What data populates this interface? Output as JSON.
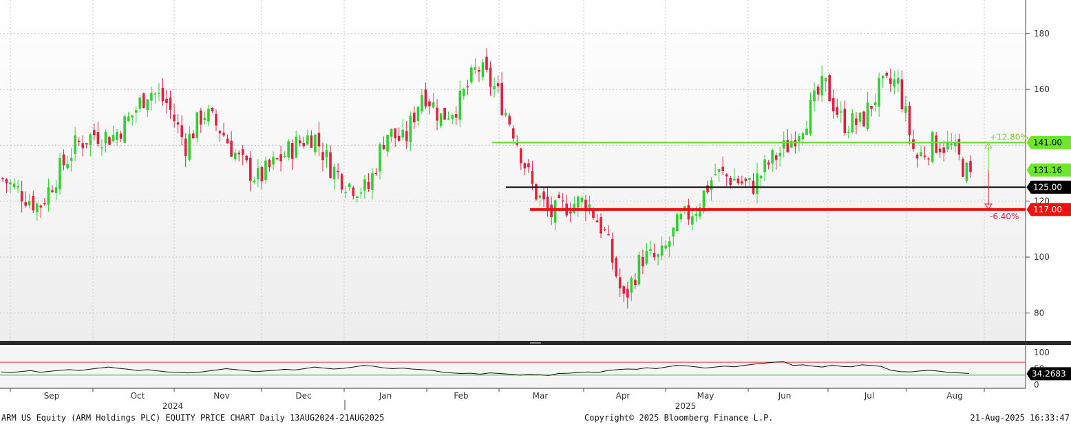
{
  "footer": {
    "left": "ARM US Equity (ARM Holdings PLC) EQUITY PRICE CHART  Daily 13AUG2024-21AUG2025",
    "center": "Copyright© 2025 Bloomberg Finance L.P.",
    "right": "21-Aug-2025 16:33:47"
  },
  "colors": {
    "up": "#2ed12e",
    "down": "#e0203c",
    "green_line": "#66dd33",
    "red_line": "#ee1111",
    "black_line": "#000000"
  },
  "chart_data": [
    {
      "type": "candlestick",
      "title": "",
      "yaxis_side": "right",
      "ylim": [
        70,
        192
      ],
      "yticks": [
        80,
        100,
        120,
        140,
        160,
        180
      ],
      "yticks_shown": [
        "80",
        "100",
        "120",
        "160",
        "180"
      ],
      "x_month_labels": [
        "Sep",
        "Oct",
        "Nov",
        "Dec",
        "Jan",
        "Feb",
        "Mar",
        "Apr",
        "May",
        "Jun",
        "Jul",
        "Aug"
      ],
      "x_year_labels": [
        "2024",
        "2025"
      ],
      "grid": true,
      "ohlc_close_path": [
        {
          "date": "2024-08-13",
          "close": 128
        },
        {
          "date": "2024-08-20",
          "close": 123
        },
        {
          "date": "2024-08-27",
          "close": 118
        },
        {
          "date": "2024-09-03",
          "close": 130
        },
        {
          "date": "2024-09-10",
          "close": 140
        },
        {
          "date": "2024-09-17",
          "close": 144
        },
        {
          "date": "2024-09-24",
          "close": 143
        },
        {
          "date": "2024-10-01",
          "close": 150
        },
        {
          "date": "2024-10-08",
          "close": 160
        },
        {
          "date": "2024-10-15",
          "close": 155
        },
        {
          "date": "2024-10-22",
          "close": 140
        },
        {
          "date": "2024-10-29",
          "close": 152
        },
        {
          "date": "2024-11-05",
          "close": 145
        },
        {
          "date": "2024-11-12",
          "close": 134
        },
        {
          "date": "2024-11-19",
          "close": 128
        },
        {
          "date": "2024-11-26",
          "close": 134
        },
        {
          "date": "2024-12-03",
          "close": 140
        },
        {
          "date": "2024-12-10",
          "close": 144
        },
        {
          "date": "2024-12-17",
          "close": 132
        },
        {
          "date": "2024-12-24",
          "close": 126
        },
        {
          "date": "2024-12-31",
          "close": 124
        },
        {
          "date": "2025-01-07",
          "close": 145
        },
        {
          "date": "2025-01-14",
          "close": 141
        },
        {
          "date": "2025-01-21",
          "close": 160
        },
        {
          "date": "2025-01-28",
          "close": 150
        },
        {
          "date": "2025-02-04",
          "close": 155
        },
        {
          "date": "2025-02-11",
          "close": 168
        },
        {
          "date": "2025-02-18",
          "close": 160
        },
        {
          "date": "2025-02-25",
          "close": 145
        },
        {
          "date": "2025-03-04",
          "close": 125
        },
        {
          "date": "2025-03-11",
          "close": 115
        },
        {
          "date": "2025-03-18",
          "close": 119
        },
        {
          "date": "2025-03-25",
          "close": 120
        },
        {
          "date": "2025-04-01",
          "close": 108
        },
        {
          "date": "2025-04-08",
          "close": 84
        },
        {
          "date": "2025-04-15",
          "close": 100
        },
        {
          "date": "2025-04-22",
          "close": 99
        },
        {
          "date": "2025-04-29",
          "close": 112
        },
        {
          "date": "2025-05-06",
          "close": 118
        },
        {
          "date": "2025-05-13",
          "close": 130
        },
        {
          "date": "2025-05-20",
          "close": 128
        },
        {
          "date": "2025-05-27",
          "close": 125
        },
        {
          "date": "2025-06-03",
          "close": 134
        },
        {
          "date": "2025-06-10",
          "close": 140
        },
        {
          "date": "2025-06-17",
          "close": 150
        },
        {
          "date": "2025-06-24",
          "close": 162
        },
        {
          "date": "2025-07-01",
          "close": 148
        },
        {
          "date": "2025-07-08",
          "close": 148
        },
        {
          "date": "2025-07-15",
          "close": 160
        },
        {
          "date": "2025-07-22",
          "close": 163
        },
        {
          "date": "2025-07-29",
          "close": 135
        },
        {
          "date": "2025-08-05",
          "close": 141
        },
        {
          "date": "2025-08-12",
          "close": 139
        },
        {
          "date": "2025-08-19",
          "close": 128
        }
      ],
      "horizontal_lines": [
        {
          "value": 141.0,
          "label": "141.00",
          "color": "#66dd33",
          "annotation": "+12.80%"
        },
        {
          "value": 125.0,
          "label": "125.00",
          "color": "#000000"
        },
        {
          "value": 117.0,
          "label": "117.00",
          "color": "#ee1111",
          "annotation": "-6.40%"
        }
      ],
      "last_price_tag": "131.16"
    },
    {
      "type": "line",
      "title": "",
      "ylim": [
        0,
        100
      ],
      "yticks": [
        "100",
        "50",
        "0"
      ],
      "reference_lines": [
        70,
        30
      ],
      "last_value_tag": "34.2683",
      "values": [
        40,
        38,
        41,
        44,
        39,
        42,
        45,
        47,
        44,
        48,
        52,
        55,
        51,
        48,
        44,
        47,
        43,
        40,
        39,
        37,
        38,
        42,
        46,
        50,
        47,
        44,
        41,
        43,
        45,
        48,
        46,
        50,
        55,
        52,
        49,
        51,
        55,
        60,
        58,
        53,
        50,
        52,
        49,
        47,
        45,
        40,
        37,
        35,
        36,
        33,
        37,
        35,
        33,
        30,
        32,
        31,
        29,
        35,
        36,
        38,
        40,
        38,
        44,
        47,
        49,
        48,
        53,
        50,
        55,
        60,
        59,
        56,
        52,
        55,
        58,
        56,
        60,
        64,
        67,
        70,
        72,
        60,
        62,
        58,
        55,
        61,
        57,
        56,
        62,
        60,
        57,
        45,
        41,
        40,
        43,
        45,
        42,
        38,
        37,
        35
      ]
    }
  ]
}
